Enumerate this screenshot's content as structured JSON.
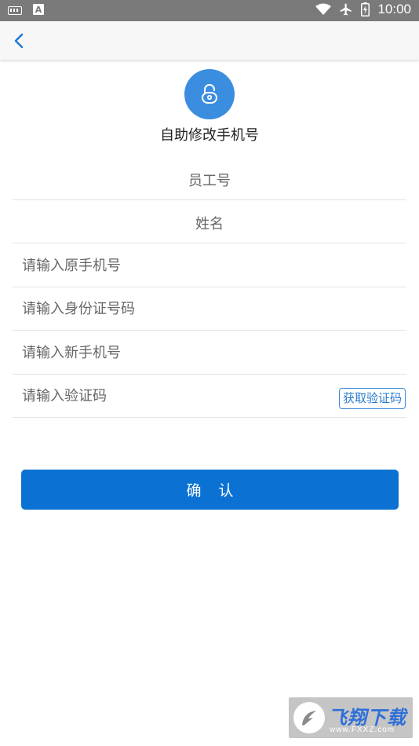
{
  "statusbar": {
    "time": "10:00",
    "icons": [
      "keyboard-icon",
      "font-a-icon",
      "wifi-icon",
      "airplane-icon",
      "battery-icon"
    ],
    "a_label": "A"
  },
  "appbar": {
    "back_icon": "chevron-left-icon"
  },
  "header": {
    "icon": "lock-icon",
    "title": "自助修改手机号"
  },
  "form": {
    "employee_id_label": "员工号",
    "name_label": "姓名",
    "old_phone": {
      "value": "",
      "placeholder": "请输入原手机号"
    },
    "id_card": {
      "value": "",
      "placeholder": "请输入身份证号码"
    },
    "new_phone": {
      "value": "",
      "placeholder": "请输入新手机号"
    },
    "code": {
      "value": "",
      "placeholder": "请输入验证码"
    },
    "get_code_label": "获取验证码"
  },
  "confirm_label": "确认",
  "watermark": {
    "text": "飞翔下载",
    "url": "www.FXXZ.com"
  },
  "colors": {
    "accent": "#0b72d3",
    "lock_circle": "#3b8de0",
    "statusbar": "#7a7a7a",
    "appbar": "#f7f7f7"
  }
}
